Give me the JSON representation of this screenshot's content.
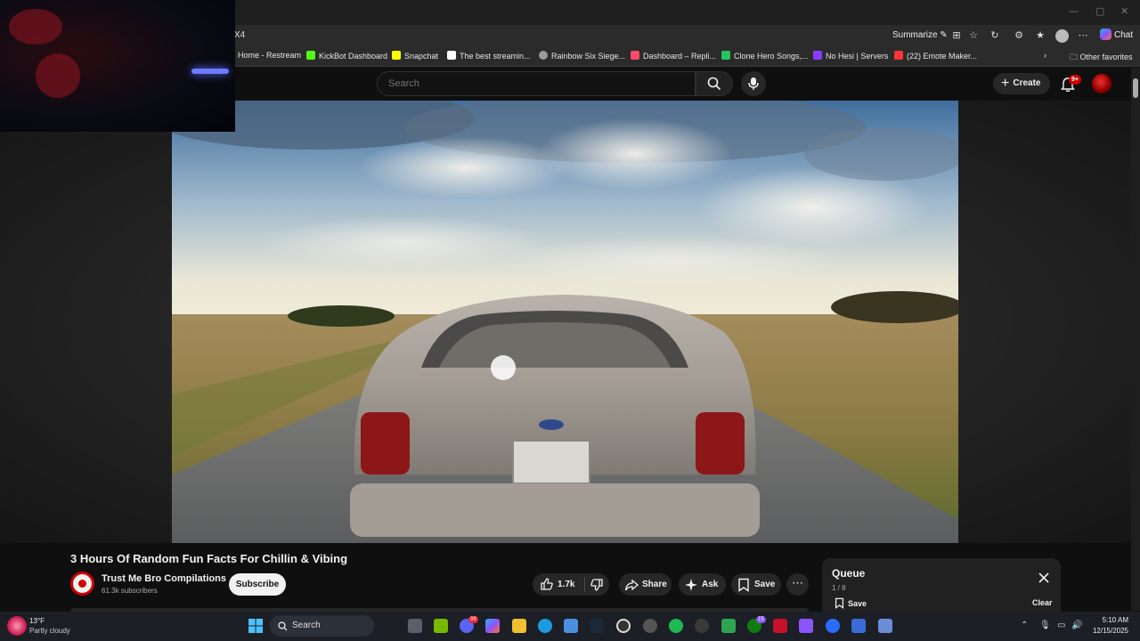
{
  "browser": {
    "url_fragment": "X4",
    "summarize_label": "Summarize",
    "chat_label": "Chat",
    "other_favorites_label": "Other favorites",
    "bookmarks": [
      {
        "label": "Home - Restream",
        "color": "#2a6cff"
      },
      {
        "label": "KickBot Dashboard",
        "color": "#53fc18"
      },
      {
        "label": "Snapchat",
        "color": "#fffc00"
      },
      {
        "label": "The best streamin...",
        "color": "#ffffff"
      },
      {
        "label": "Rainbow Six Siege...",
        "color": "#9a9a9a"
      },
      {
        "label": "Dashboard – Repli...",
        "color": "#ff4a6a"
      },
      {
        "label": "Clone Hero Songs,...",
        "color": "#22c55e"
      },
      {
        "label": "No Hesi | Servers",
        "color": "#8b3dff"
      },
      {
        "label": "(22) Emote Maker...",
        "color": "#ff3333"
      }
    ]
  },
  "youtube": {
    "search_placeholder": "Search",
    "create_label": "Create",
    "notifications_badge": "9+"
  },
  "video": {
    "title": "3 Hours Of Random Fun Facts For Chillin & Vibing",
    "channel_name": "Trust Me Bro Compilations",
    "subscribers": "61.3k subscribers",
    "subscribe_label": "Subscribe",
    "like_count": "1.7k",
    "share_label": "Share",
    "ask_label": "Ask",
    "save_label": "Save",
    "more_label": "⋯"
  },
  "queue": {
    "title": "Queue",
    "position": "1 / 8",
    "save_label": "Save",
    "clear_label": "Clear"
  },
  "taskbar": {
    "weather_temp": "13°F",
    "weather_desc": "Partly cloudy",
    "search_label": "Search",
    "time": "5:10 AM",
    "date": "12/15/2025",
    "badges": {
      "discord": "99",
      "xbox": "15"
    }
  },
  "colors": {
    "yt_bg": "#0f0f0f",
    "pill_bg": "#272727",
    "accent_red": "#cc0000"
  }
}
